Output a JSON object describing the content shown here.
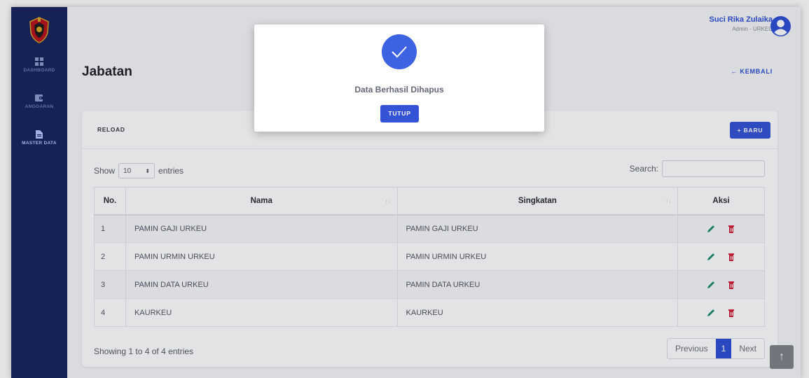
{
  "sidebar": {
    "items": [
      {
        "label": "DASHBOARD",
        "icon": "dashboard-grid-icon"
      },
      {
        "label": "ANGGARAN",
        "icon": "wallet-icon"
      },
      {
        "label": "MASTER DATA",
        "icon": "document-icon"
      }
    ]
  },
  "user": {
    "name": "Suci Rika Zulaika",
    "role": "Admin - URKEU"
  },
  "page": {
    "title": "Jabatan",
    "back_label": "← KEMBALI"
  },
  "toolbar": {
    "reload_label": "RELOAD",
    "new_label": "+ BARU"
  },
  "table_controls": {
    "show_label": "Show",
    "length_value": "10",
    "entries_label": "entries",
    "search_label": "Search:",
    "search_value": ""
  },
  "table": {
    "headers": [
      "No.",
      "Nama",
      "Singkatan",
      "Aksi"
    ],
    "rows": [
      {
        "no": "1",
        "nama": "PAMIN GAJI URKEU",
        "singkatan": "PAMIN GAJI URKEU"
      },
      {
        "no": "2",
        "nama": "PAMIN URMIN URKEU",
        "singkatan": "PAMIN URMIN URKEU"
      },
      {
        "no": "3",
        "nama": "PAMIN DATA URKEU",
        "singkatan": "PAMIN DATA URKEU"
      },
      {
        "no": "4",
        "nama": "KAURKEU",
        "singkatan": "KAURKEU"
      }
    ]
  },
  "footer": {
    "info": "Showing 1 to 4 of 4 entries",
    "prev_label": "Previous",
    "page_label": "1",
    "next_label": "Next"
  },
  "modal": {
    "message": "Data Berhasil Dihapus",
    "button_label": "TUTUP"
  },
  "colors": {
    "sidebar": "#17245c",
    "accent": "#2d4fd6",
    "edit": "#1a8a6a",
    "delete": "#d4213d"
  }
}
